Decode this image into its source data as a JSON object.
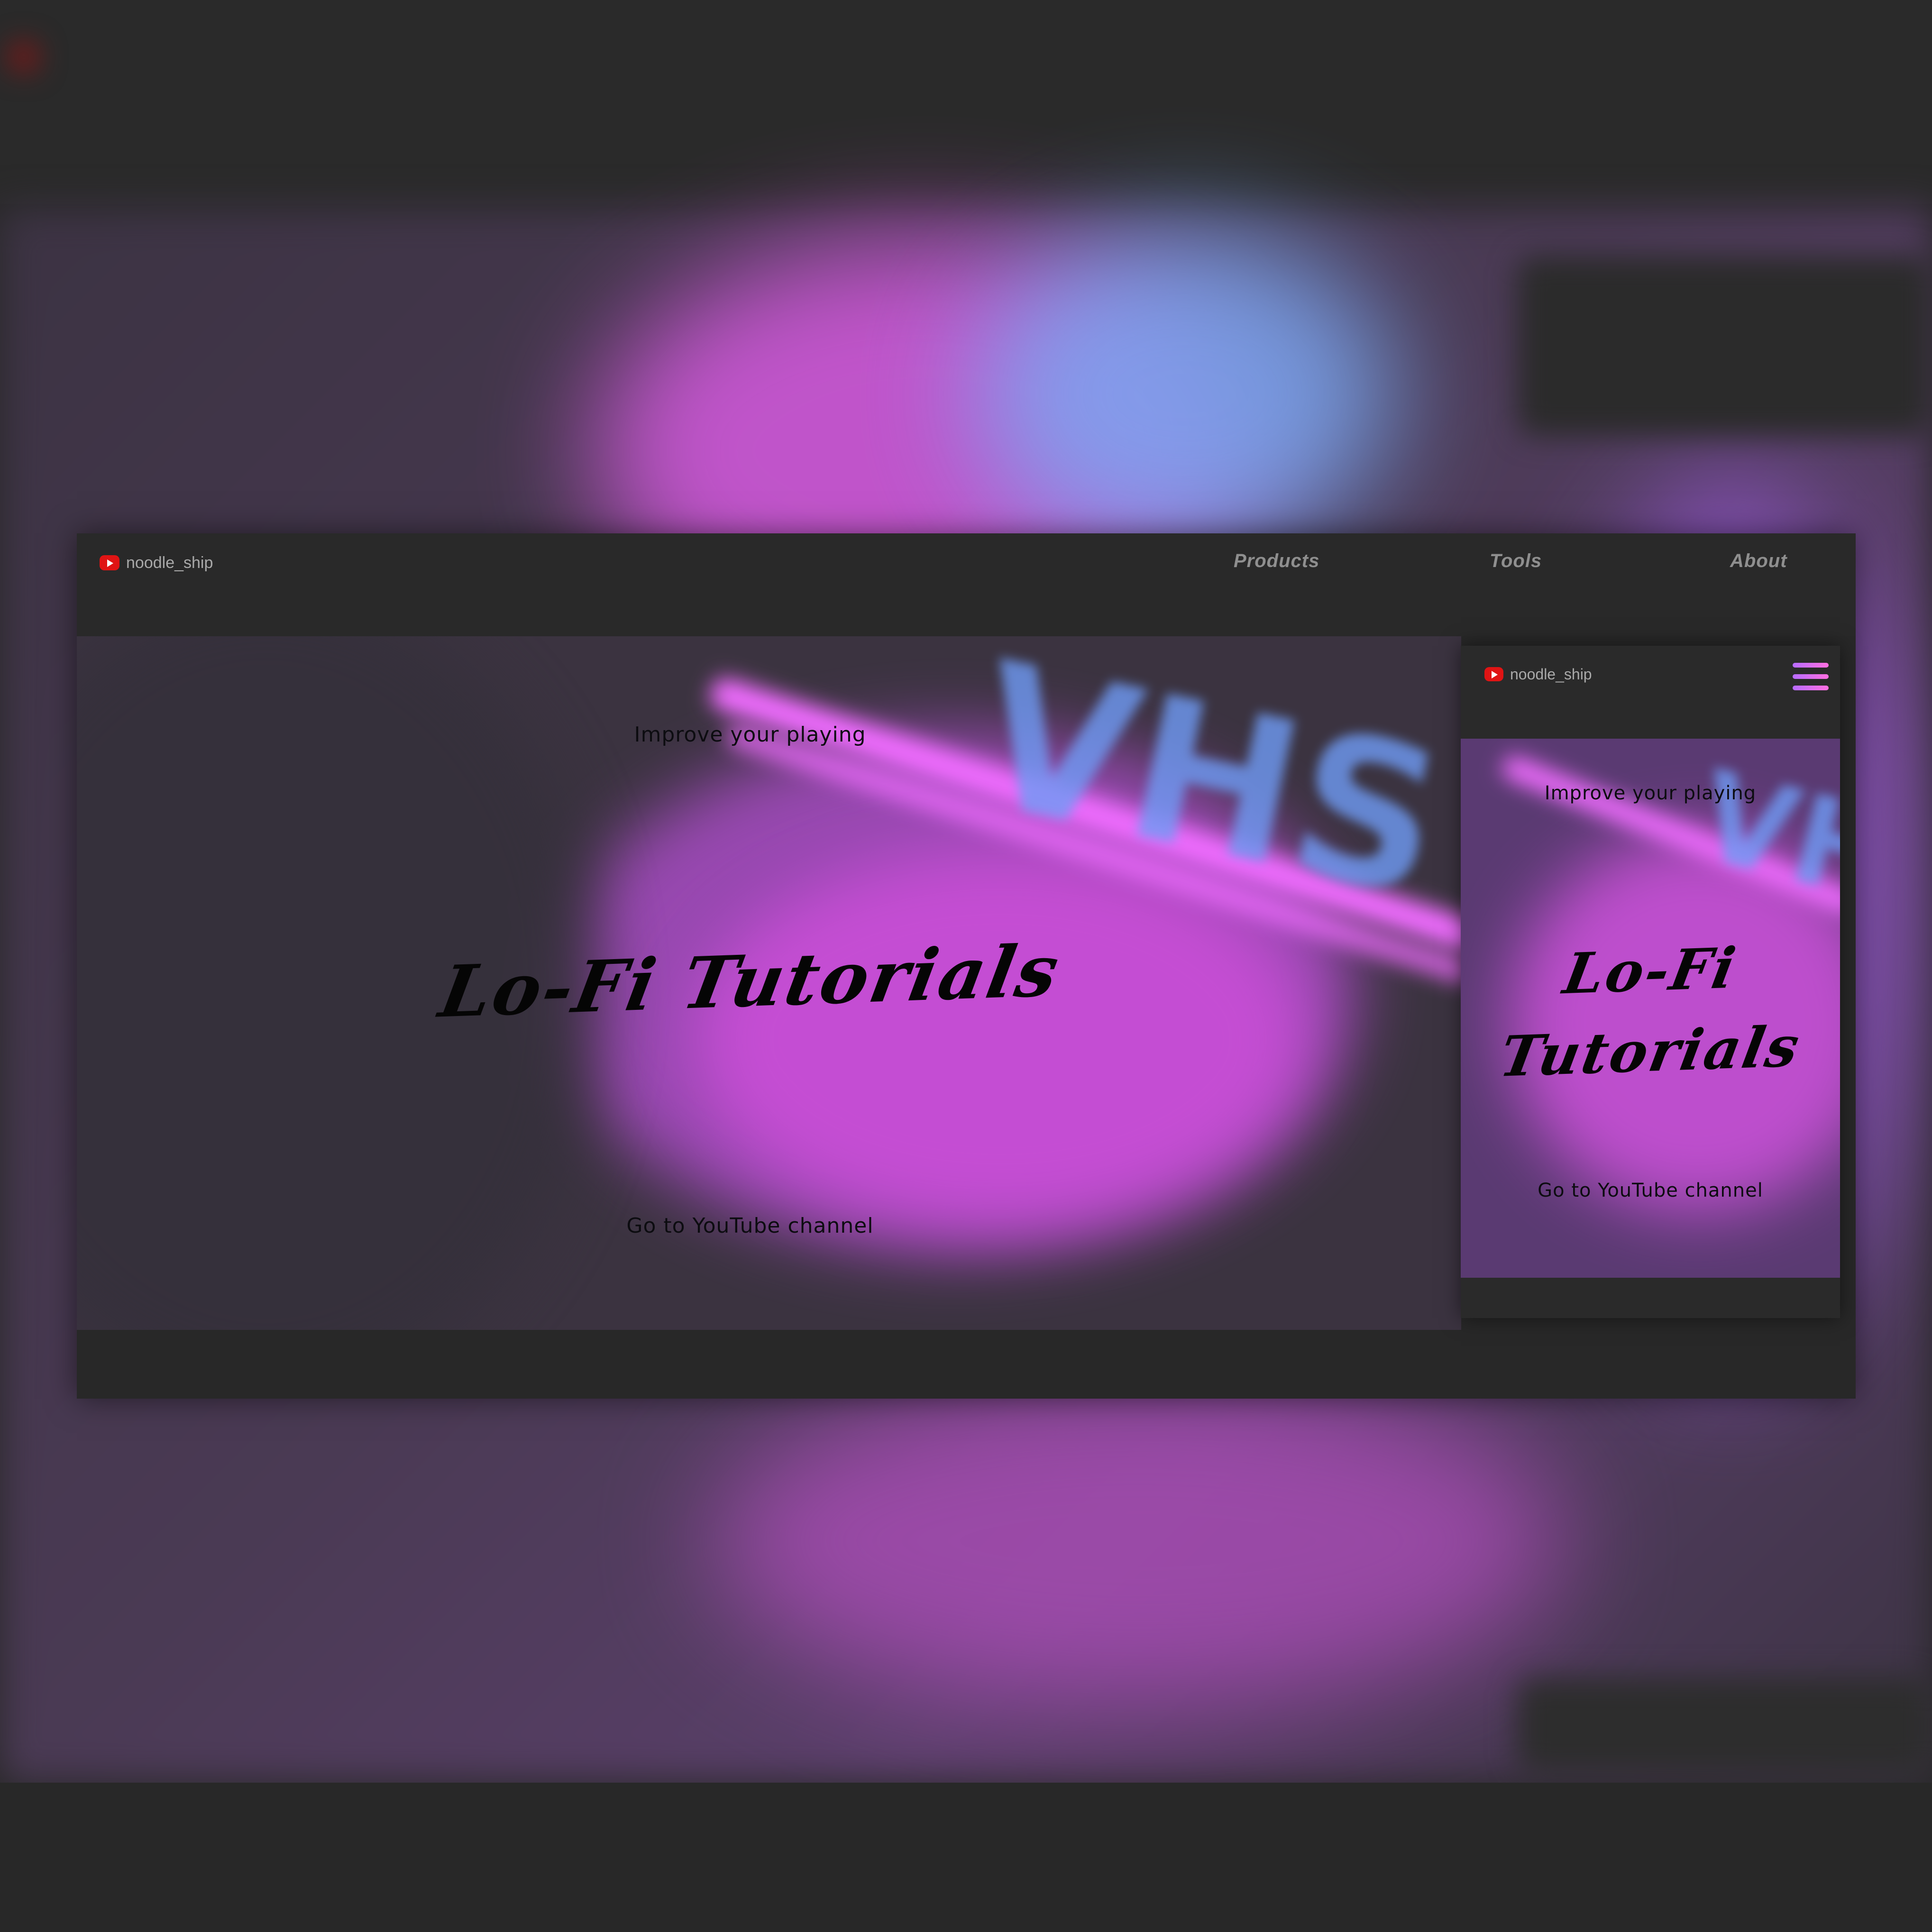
{
  "desktop": {
    "brand": "noodle_ship",
    "nav": {
      "products": "Products",
      "tools": "Tools",
      "about": "About"
    },
    "hero": {
      "subtitle": "Improve your playing",
      "title": "Lo-Fi Tutorials",
      "cta": "Go to YouTube channel",
      "neon_sign": "VHS"
    }
  },
  "mobile": {
    "brand": "noodle_ship",
    "menu_icon": "hamburger-icon",
    "hero": {
      "subtitle": "Improve your playing",
      "title_line1": "Lo-Fi",
      "title_line2": "Tutorials",
      "cta": "Go to YouTube channel",
      "neon_sign": "VHS"
    }
  },
  "icons": {
    "brand_logo": "youtube-icon",
    "menu": "hamburger-icon"
  },
  "colors": {
    "background": "#282828",
    "navbar": "#292929",
    "accent_pink": "#f06cff",
    "accent_blue": "#6f9bf5",
    "youtube_red": "#e01414",
    "nav_text": "#8f8f8f",
    "hero_text": "#050505"
  }
}
